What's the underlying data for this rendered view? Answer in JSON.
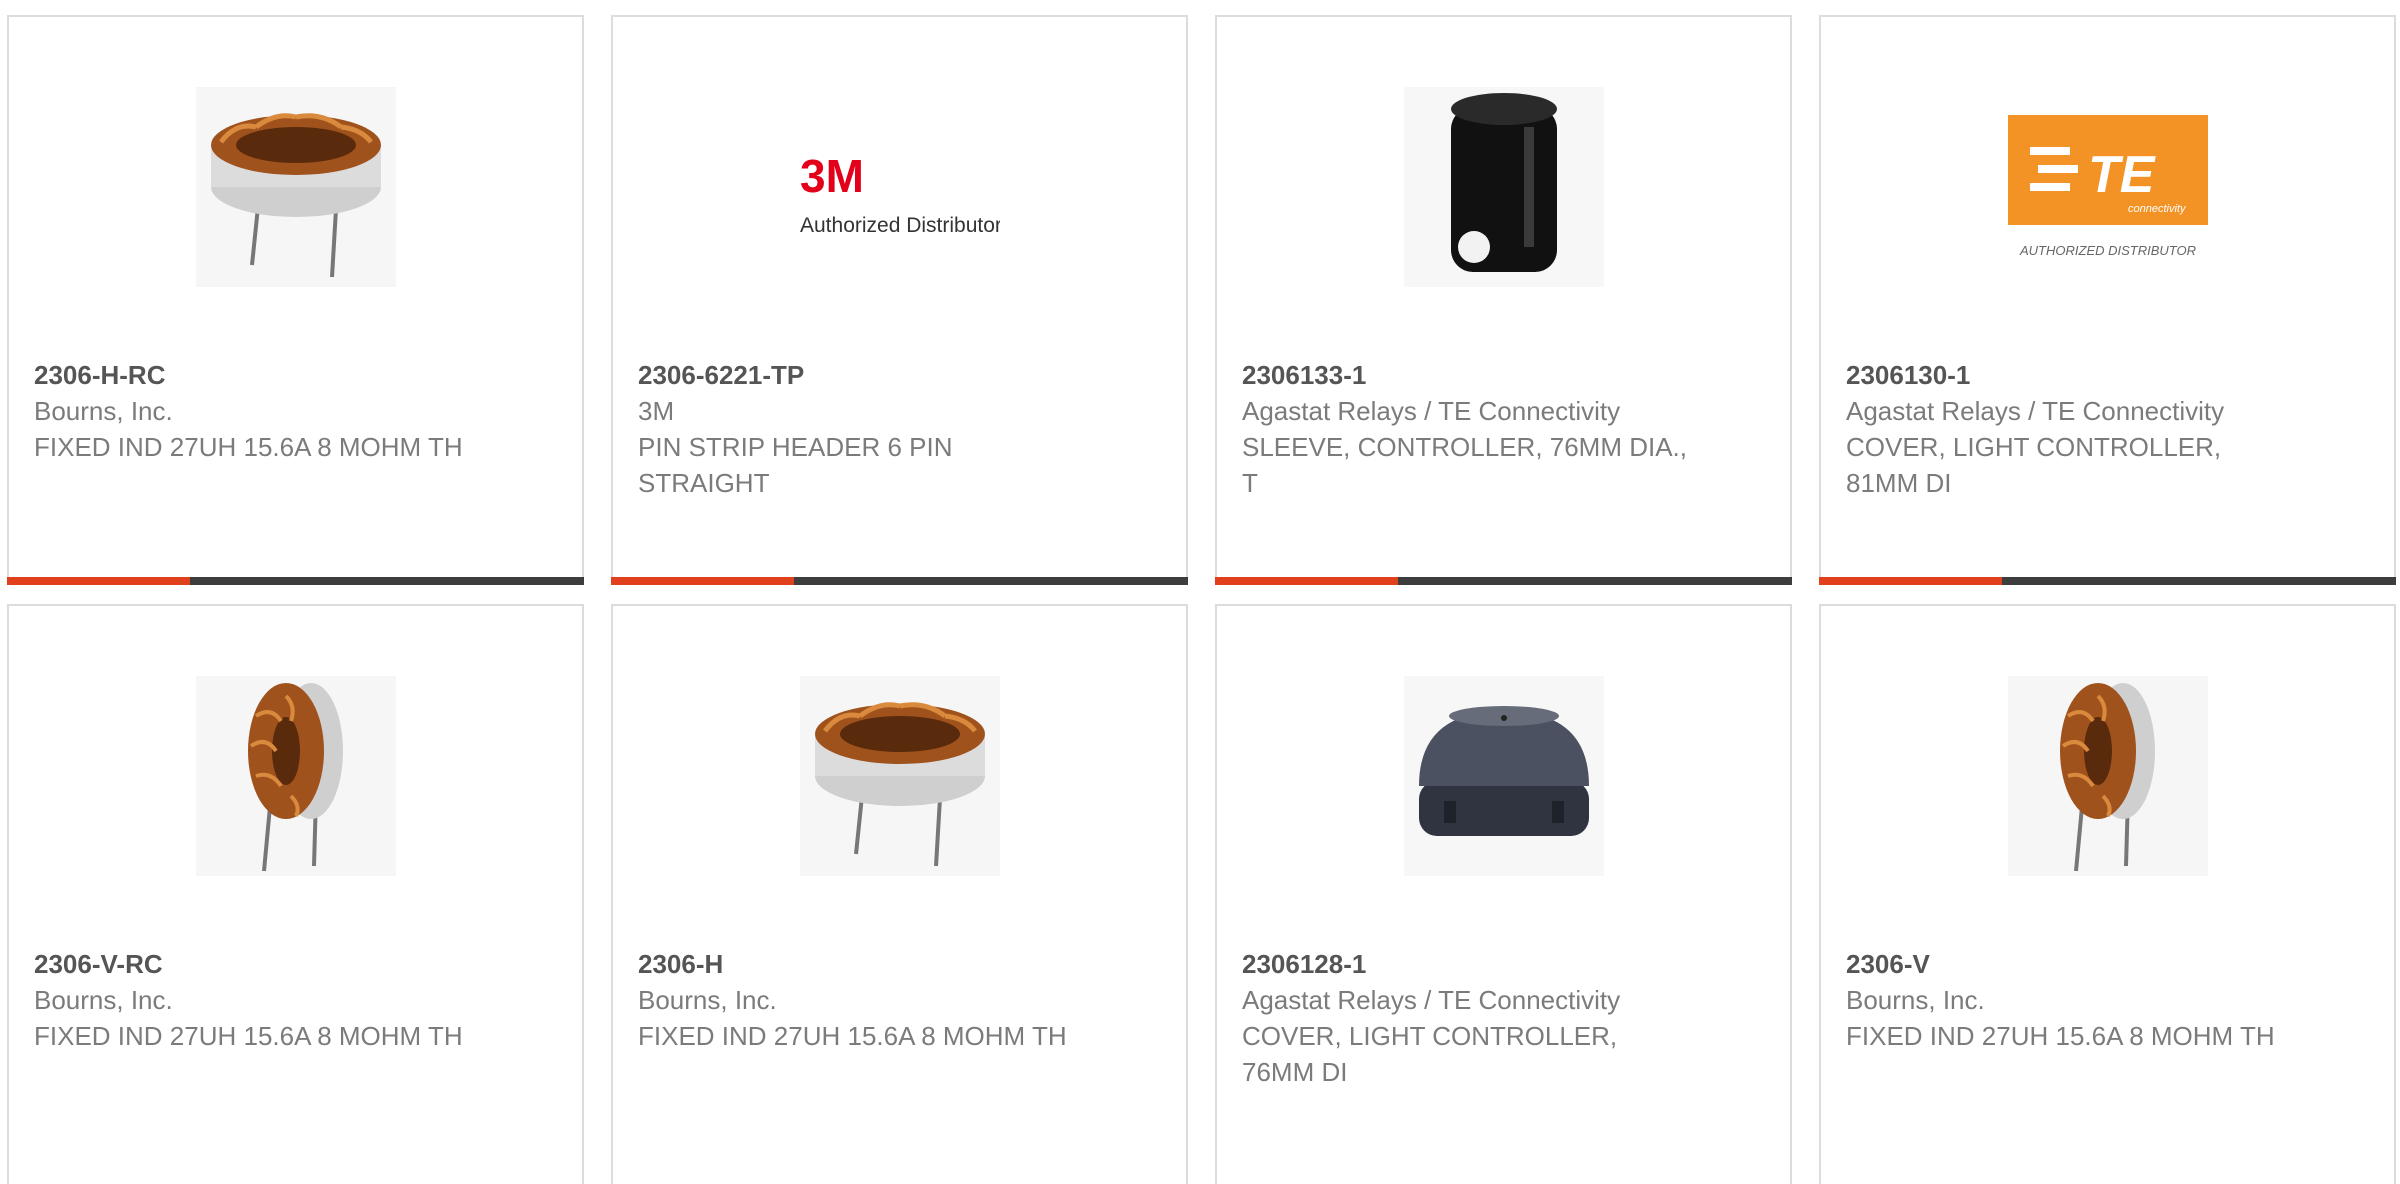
{
  "products": [
    {
      "part_number": "2306-H-RC",
      "manufacturer": "Bourns, Inc.",
      "description": "FIXED IND 27UH 15.6A 8 MOHM TH",
      "image": "toroid-inductor-horizontal-icon"
    },
    {
      "part_number": "2306-6221-TP",
      "manufacturer": "3M",
      "description": "PIN STRIP HEADER 6 PIN STRAIGHT",
      "image": "3m-authorized-distributor-logo"
    },
    {
      "part_number": "2306133-1",
      "manufacturer": "Agastat Relays / TE Connectivity",
      "description": "SLEEVE, CONTROLLER, 76MM DIA., T",
      "image": "black-sleeve-icon"
    },
    {
      "part_number": "2306130-1",
      "manufacturer": "Agastat Relays / TE Connectivity",
      "description": "COVER, LIGHT CONTROLLER, 81MM DI",
      "image": "te-authorized-distributor-logo"
    },
    {
      "part_number": "2306-V-RC",
      "manufacturer": "Bourns, Inc.",
      "description": "FIXED IND 27UH 15.6A 8 MOHM TH",
      "image": "toroid-inductor-vertical-icon"
    },
    {
      "part_number": "2306-H",
      "manufacturer": "Bourns, Inc.",
      "description": "FIXED IND 27UH 15.6A 8 MOHM TH",
      "image": "toroid-inductor-horizontal-icon"
    },
    {
      "part_number": "2306128-1",
      "manufacturer": "Agastat Relays / TE Connectivity",
      "description": "COVER, LIGHT CONTROLLER, 76MM DI",
      "image": "smoked-dome-cover-icon"
    },
    {
      "part_number": "2306-V",
      "manufacturer": "Bourns, Inc.",
      "description": "FIXED IND 27UH 15.6A 8 MOHM TH",
      "image": "toroid-inductor-vertical-icon"
    }
  ],
  "logos": {
    "threem_mark": "3M",
    "threem_tagline": "Authorized Distributor",
    "te_mark": "TE",
    "te_sub": "connectivity",
    "te_tagline": "AUTHORIZED DISTRIBUTOR"
  },
  "colors": {
    "accent": "#e0401c",
    "bar": "#3d3d3d",
    "border": "#dcdcdc",
    "part_number": "#555555",
    "text": "#7b7b7b",
    "te_orange": "#f39325",
    "threem_red": "#e2001a"
  }
}
